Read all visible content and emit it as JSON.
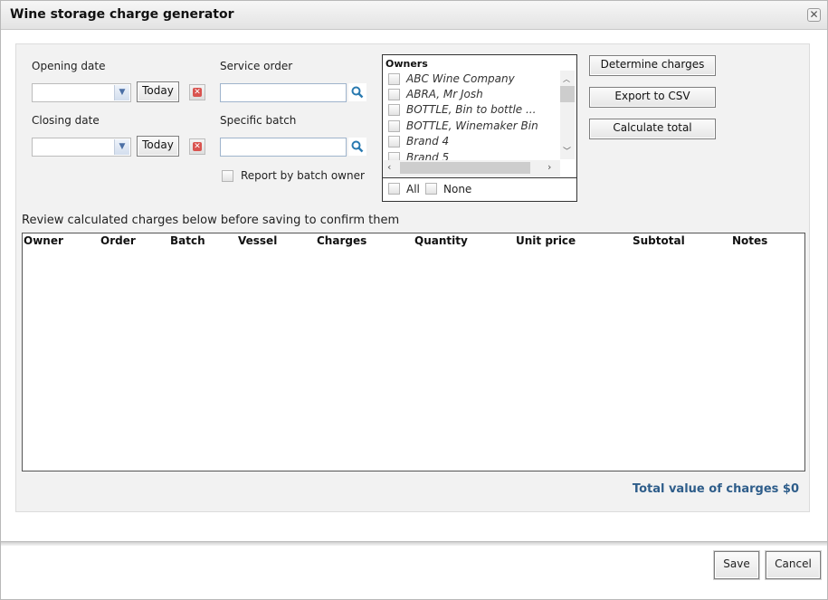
{
  "window": {
    "title": "Wine storage charge generator"
  },
  "filters": {
    "opening_date_label": "Opening date",
    "closing_date_label": "Closing date",
    "today_label": "Today",
    "service_order_label": "Service order",
    "specific_batch_label": "Specific batch",
    "report_by_batch_owner_label": "Report by batch owner"
  },
  "owners": {
    "title": "Owners",
    "items": [
      "ABC Wine Company",
      "ABRA, Mr Josh",
      "BOTTLE, Bin to bottle ...",
      "BOTTLE, Winemaker Bin",
      "Brand 4",
      "Brand 5"
    ],
    "all_label": "All",
    "none_label": "None"
  },
  "actions": {
    "determine_charges": "Determine charges",
    "export_csv": "Export to CSV",
    "calculate_total": "Calculate total"
  },
  "review_text": "Review calculated charges below before saving to confirm them",
  "table": {
    "columns": [
      "Owner",
      "Order",
      "Batch",
      "Vessel",
      "Charges",
      "Quantity",
      "Unit price",
      "Subtotal",
      "Notes"
    ]
  },
  "total_text": "Total value of charges $0",
  "footer": {
    "save": "Save",
    "cancel": "Cancel"
  },
  "colors": {
    "accent_text": "#2e5d8a",
    "clear_red": "#d9534f",
    "search_blue": "#2a7ab0"
  }
}
